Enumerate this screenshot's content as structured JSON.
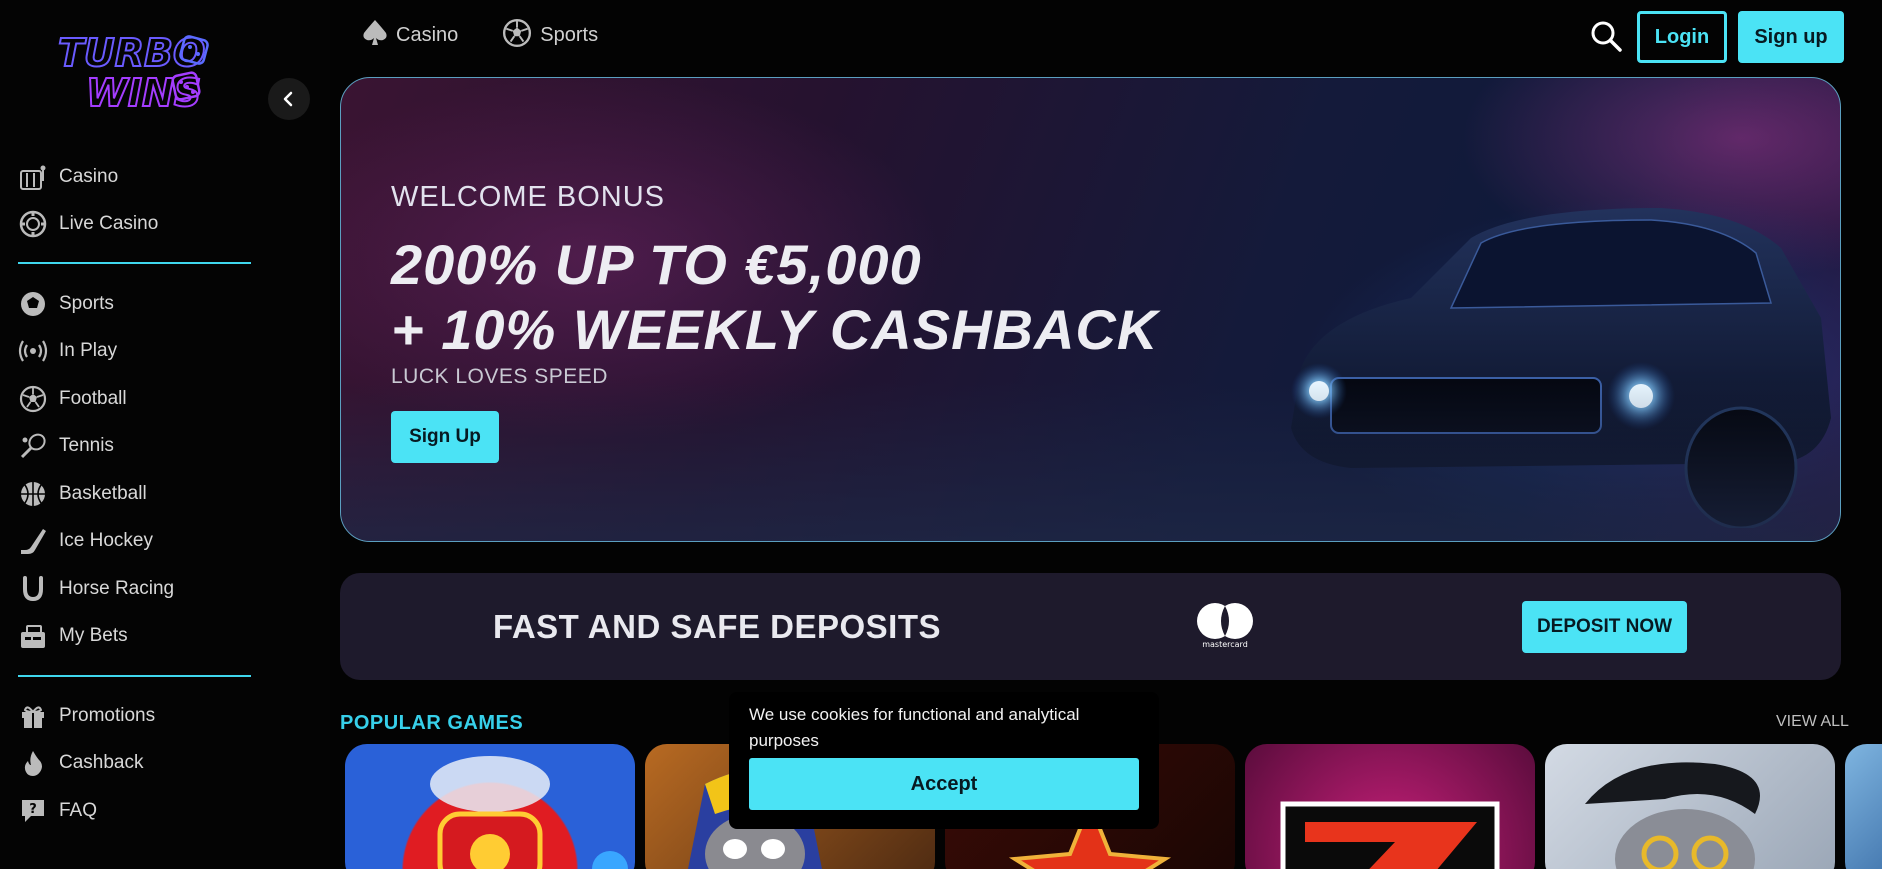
{
  "brand": {
    "logo_line1": "TURBO",
    "logo_line2": "WINS",
    "accent": "#4be3f5",
    "logo_color": "#8b4dff"
  },
  "sidebar": {
    "group1": [
      {
        "label": "Casino",
        "icon": "slot-machine-icon"
      },
      {
        "label": "Live Casino",
        "icon": "poker-chip-icon"
      }
    ],
    "group2": [
      {
        "label": "Sports",
        "icon": "sports-badge-icon"
      },
      {
        "label": "In Play",
        "icon": "broadcast-icon"
      },
      {
        "label": "Football",
        "icon": "soccer-ball-icon"
      },
      {
        "label": "Tennis",
        "icon": "tennis-racket-icon"
      },
      {
        "label": "Basketball",
        "icon": "basketball-icon"
      },
      {
        "label": "Ice Hockey",
        "icon": "hockey-stick-icon"
      },
      {
        "label": "Horse Racing",
        "icon": "horseshoe-icon"
      },
      {
        "label": "My Bets",
        "icon": "ticket-icon"
      }
    ],
    "group3": [
      {
        "label": "Promotions",
        "icon": "gift-icon"
      },
      {
        "label": "Cashback",
        "icon": "flame-icon"
      },
      {
        "label": "FAQ",
        "icon": "question-chat-icon"
      }
    ]
  },
  "topnav": {
    "casino_label": "Casino",
    "sports_label": "Sports",
    "login_label": "Login",
    "signup_label": "Sign up"
  },
  "hero": {
    "kicker": "WELCOME BONUS",
    "title_line1": "200% UP TO €5,000",
    "title_line2": "+ 10% WEEKLY CASHBACK",
    "tagline": "LUCK LOVES SPEED",
    "cta": "Sign Up"
  },
  "deposit": {
    "title": "FAST AND SAFE DEPOSITS",
    "payment_logo_text": "mastercard",
    "cta": "DEPOSIT NOW"
  },
  "popular": {
    "title": "POPULAR GAMES",
    "view_all": "VIEW ALL"
  },
  "cookie": {
    "text": "We use cookies for functional and analytical purposes",
    "accept": "Accept"
  }
}
